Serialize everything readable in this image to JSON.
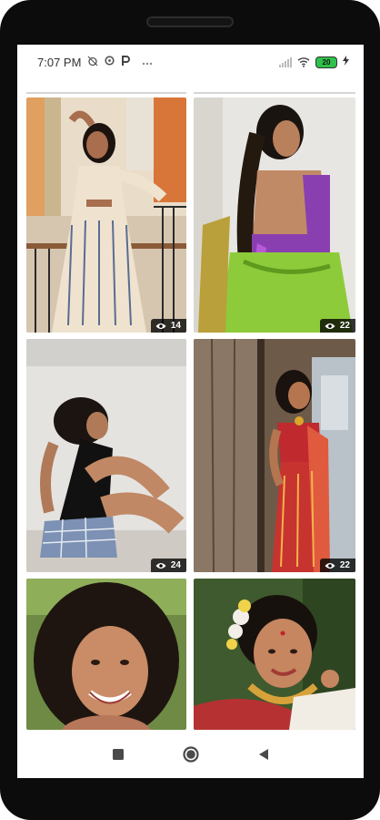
{
  "status_bar": {
    "time": "7:07 PM",
    "battery": "20"
  },
  "gallery": {
    "items": [
      {
        "views": "14"
      },
      {
        "views": "22"
      },
      {
        "views": "24"
      },
      {
        "views": "22"
      },
      {
        "views": ""
      },
      {
        "views": ""
      }
    ]
  },
  "icons": {
    "status": [
      "alarm-off-icon",
      "data-saver-icon",
      "p-app-icon",
      "more-dots-icon",
      "signal-icon",
      "wifi-icon",
      "battery-icon",
      "charging-icon"
    ],
    "badge": "eye-icon",
    "nav": [
      "recent-apps-icon",
      "home-icon",
      "back-icon"
    ]
  },
  "colors": {
    "battery_fill": "#2ec24a",
    "badge_bg": "#000000",
    "phone_frame": "#0c0c0c"
  }
}
